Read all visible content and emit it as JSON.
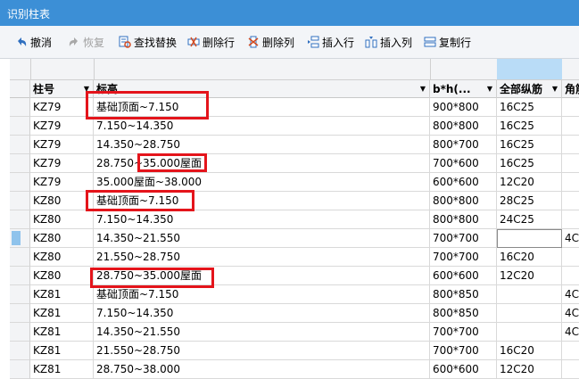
{
  "window": {
    "title": "识别柱表"
  },
  "toolbar": [
    {
      "label": "撤消",
      "icon": "undo-icon",
      "enabled": true
    },
    {
      "label": "恢复",
      "icon": "redo-icon",
      "enabled": false
    },
    {
      "label": "查找替换",
      "icon": "find-replace-icon",
      "enabled": true
    },
    {
      "label": "删除行",
      "icon": "delete-row-icon",
      "enabled": true
    },
    {
      "label": "删除列",
      "icon": "delete-column-icon",
      "enabled": true
    },
    {
      "label": "插入行",
      "icon": "insert-row-icon",
      "enabled": true
    },
    {
      "label": "插入列",
      "icon": "insert-column-icon",
      "enabled": true
    },
    {
      "label": "复制行",
      "icon": "copy-row-icon",
      "enabled": true
    }
  ],
  "table": {
    "headers": [
      "柱号",
      "标高",
      "b*h(...",
      "全部纵筋",
      "角筋"
    ],
    "rows": [
      [
        "KZ79",
        "基础顶面~7.150",
        "900*800",
        "16C25",
        ""
      ],
      [
        "KZ79",
        "7.150~14.350",
        "800*800",
        "16C25",
        ""
      ],
      [
        "KZ79",
        "14.350~28.750",
        "800*700",
        "16C25",
        ""
      ],
      [
        "KZ79",
        "28.750~35.000屋面",
        "700*600",
        "16C25",
        ""
      ],
      [
        "KZ79",
        "35.000屋面~38.000",
        "600*600",
        "12C20",
        ""
      ],
      [
        "KZ80",
        "基础顶面~7.150",
        "800*800",
        "28C25",
        ""
      ],
      [
        "KZ80",
        "7.150~14.350",
        "800*800",
        "24C25",
        ""
      ],
      [
        "KZ80",
        "14.350~21.550",
        "700*700",
        "",
        "4C"
      ],
      [
        "KZ80",
        "21.550~28.750",
        "700*700",
        "16C20",
        ""
      ],
      [
        "KZ80",
        "28.750~35.000屋面",
        "600*600",
        "12C20",
        ""
      ],
      [
        "KZ81",
        "基础顶面~7.150",
        "800*850",
        "",
        "4C"
      ],
      [
        "KZ81",
        "7.150~14.350",
        "800*850",
        "",
        "4C"
      ],
      [
        "KZ81",
        "14.350~21.550",
        "700*700",
        "",
        "4C"
      ],
      [
        "KZ81",
        "21.550~28.750",
        "700*700",
        "16C20",
        ""
      ],
      [
        "KZ81",
        "28.750~38.000",
        "600*600",
        "12C20",
        ""
      ]
    ]
  },
  "colors": {
    "titlebar": "#3c8fd6",
    "highlight": "#e4141b",
    "selected_column": "#b9dcf7",
    "row_marker": "#8fc3ec"
  }
}
